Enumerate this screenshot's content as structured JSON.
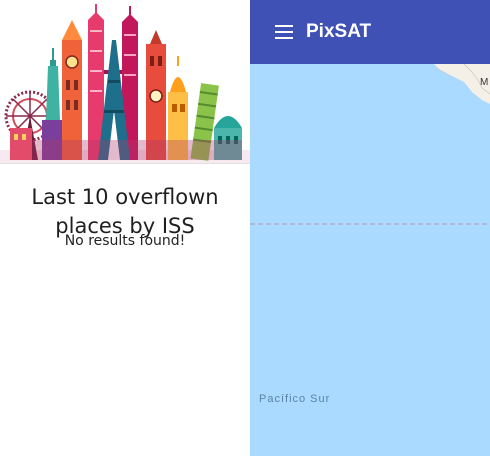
{
  "sidebar": {
    "illustration": "world-landmarks-skyline",
    "title": "Last 10 overflown places by ISS",
    "empty_message": "No results found!"
  },
  "header": {
    "menu_icon": "hamburger-menu-icon",
    "app_title": "PixSAT",
    "color": "#3f51b5"
  },
  "map": {
    "ocean_label": "Pacífico Sur",
    "corner_label": "M",
    "water_color": "#aadaff",
    "land_color": "#f4f0e8"
  }
}
